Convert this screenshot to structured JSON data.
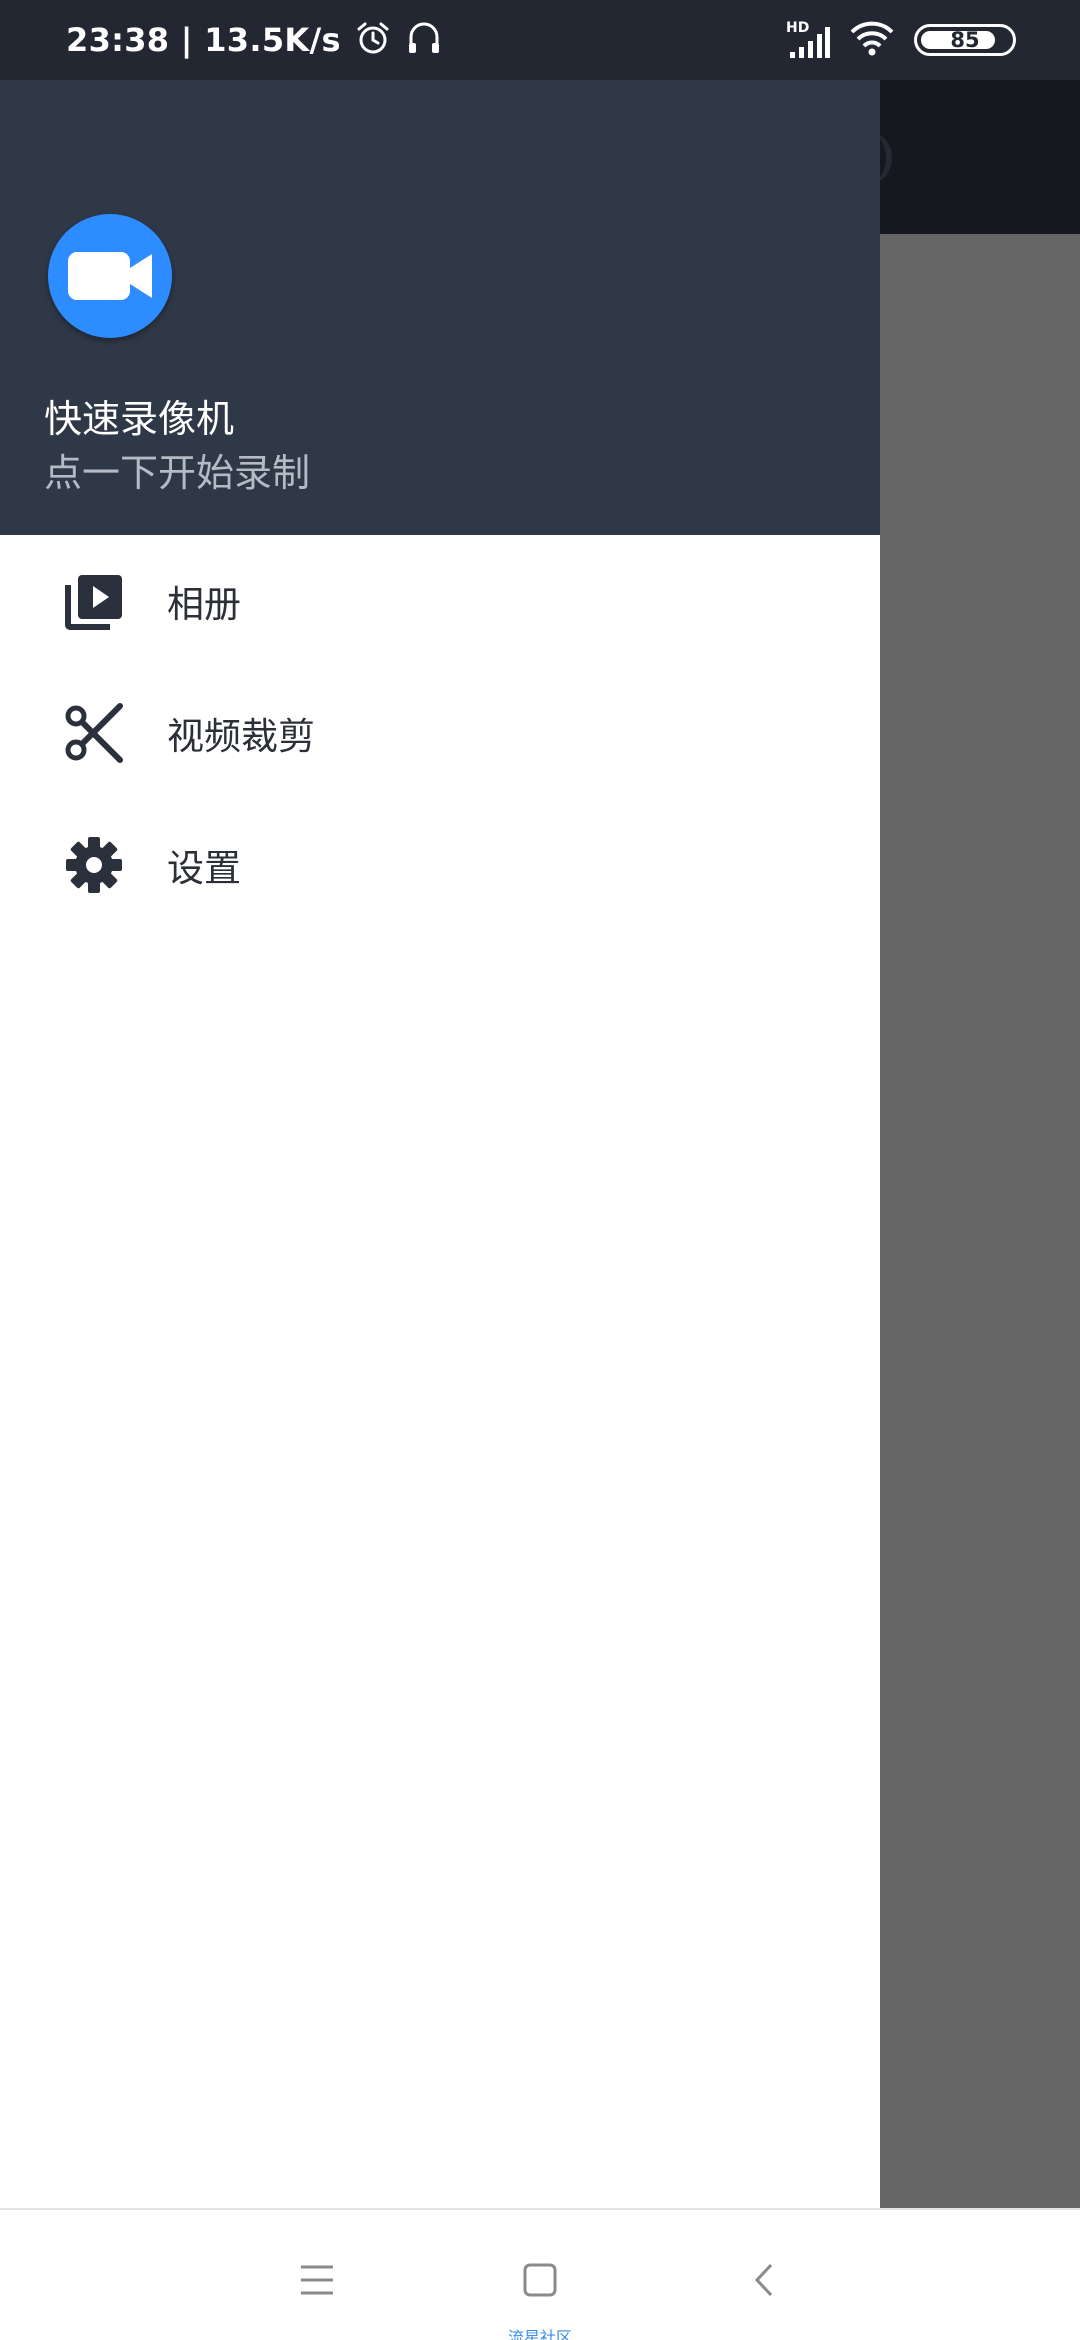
{
  "status_bar": {
    "time_speed": "23:38 | 13.5K/s",
    "network_label": "HD",
    "battery": "85",
    "battery_level": 0.85
  },
  "drawer": {
    "header": {
      "app_name": "快速录像机",
      "subtitle": "点一下开始录制",
      "logo_icon": "video-camera-icon",
      "logo_color": "#2d8cff"
    },
    "items": [
      {
        "label": "相册",
        "icon": "video-library-icon"
      },
      {
        "label": "视频裁剪",
        "icon": "scissors-icon"
      },
      {
        "label": "设置",
        "icon": "gear-icon"
      }
    ]
  },
  "nav_bar": {
    "buttons": [
      "menu-icon",
      "home-icon",
      "back-icon"
    ],
    "watermark": "流星社区"
  },
  "colors": {
    "header_bg": "#2f3847",
    "status_bg": "#222731",
    "icon_dark": "#2b313c",
    "scrim": "#666666"
  }
}
